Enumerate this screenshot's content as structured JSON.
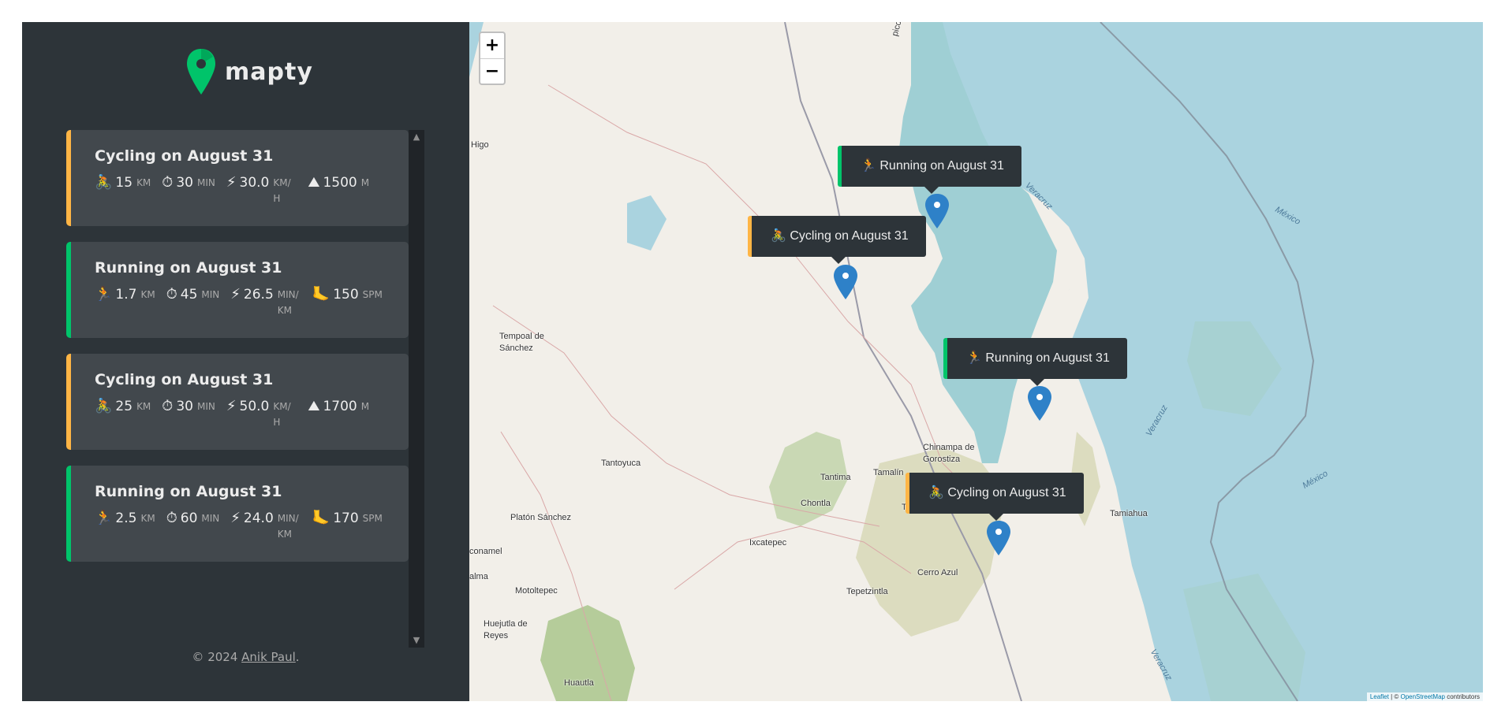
{
  "brand": {
    "name": "mapty"
  },
  "workouts": [
    {
      "type": "cycling",
      "title": "Cycling on August 31",
      "d1_icon": "🚴",
      "d1_val": "15",
      "d1_unit": "km",
      "d2_icon": "⏱",
      "d2_val": "30",
      "d2_unit": "min",
      "d3_icon": "⚡",
      "d3_val": "30.0",
      "d3_unit": "km/h",
      "d4_icon": "⛰",
      "d4_val": "1500",
      "d4_unit": "m"
    },
    {
      "type": "running",
      "title": "Running on August 31",
      "d1_icon": "🏃",
      "d1_val": "1.7",
      "d1_unit": "km",
      "d2_icon": "⏱",
      "d2_val": "45",
      "d2_unit": "min",
      "d3_icon": "⚡",
      "d3_val": "26.5",
      "d3_unit": "min/km",
      "d4_icon": "🦶",
      "d4_val": "150",
      "d4_unit": "spm"
    },
    {
      "type": "cycling",
      "title": "Cycling on August 31",
      "d1_icon": "🚴",
      "d1_val": "25",
      "d1_unit": "km",
      "d2_icon": "⏱",
      "d2_val": "30",
      "d2_unit": "min",
      "d3_icon": "⚡",
      "d3_val": "50.0",
      "d3_unit": "km/h",
      "d4_icon": "⛰",
      "d4_val": "1700",
      "d4_unit": "m"
    },
    {
      "type": "running",
      "title": "Running on August 31",
      "d1_icon": "🏃",
      "d1_val": "2.5",
      "d1_unit": "km",
      "d2_icon": "⏱",
      "d2_val": "60",
      "d2_unit": "min",
      "d3_icon": "⚡",
      "d3_val": "24.0",
      "d3_unit": "min/km",
      "d4_icon": "🦶",
      "d4_val": "170",
      "d4_unit": "spm"
    }
  ],
  "footer": {
    "prefix": "© 2024 ",
    "author": "Anik Paul",
    "suffix": "."
  },
  "map": {
    "zoom_in": "+",
    "zoom_out": "−",
    "popups": [
      {
        "type": "running",
        "icon": "🏃",
        "text": "Running on August 31"
      },
      {
        "type": "cycling",
        "icon": "🚴",
        "text": "Cycling on August 31"
      },
      {
        "type": "running",
        "icon": "🏃",
        "text": "Running on August 31"
      },
      {
        "type": "cycling",
        "icon": "🚴",
        "text": "Cycling on August 31"
      }
    ],
    "places": [
      "Higo",
      "Tempoal de Sánchez",
      "Tantoyuca",
      "Platón Sánchez",
      "Chontla",
      "Tantima",
      "Tamalín",
      "Chinampa de Gorostiza",
      "Ixcatepec",
      "Cerro Azul",
      "Tepetzintla",
      "Motoltepec",
      "Huejutla de Reyes",
      "Huautla",
      "Tamiahua",
      "conamel",
      "alma",
      "Tanc",
      "pico"
    ],
    "water_labels": [
      "Veracruz",
      "México",
      "Veracruz",
      "México",
      "Veracruz"
    ],
    "attribution": {
      "leaflet": "Leaflet",
      "sep": " | © ",
      "osm": "OpenStreetMap",
      "tail": " contributors"
    }
  }
}
